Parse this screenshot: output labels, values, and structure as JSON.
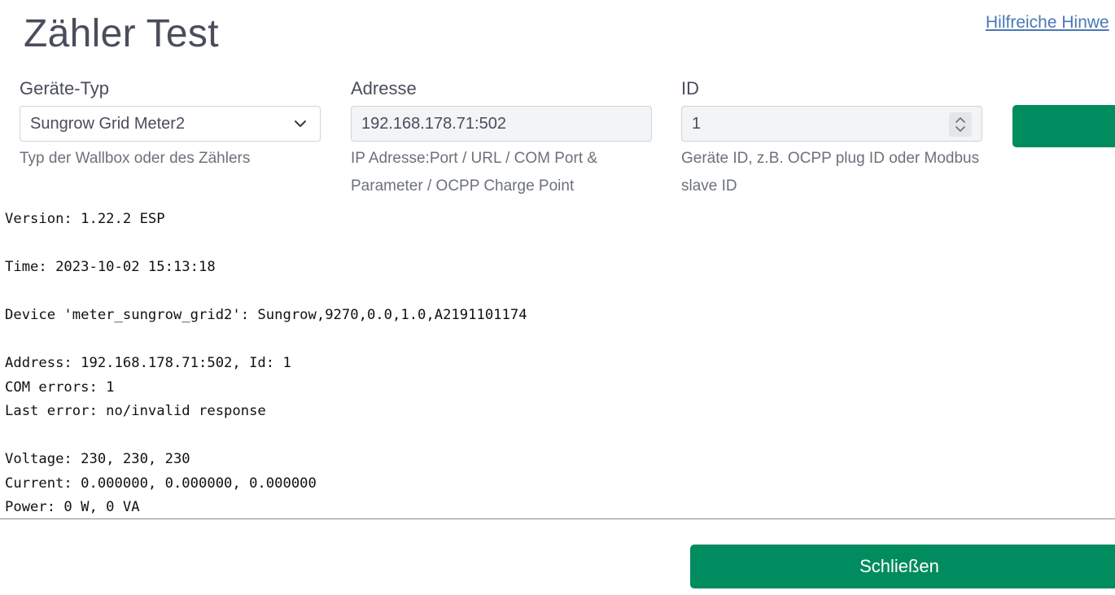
{
  "header": {
    "title": "Zähler Test",
    "help_link": "Hilfreiche Hinwe"
  },
  "form": {
    "device_type": {
      "label": "Geräte-Typ",
      "value": "Sungrow Grid Meter2",
      "help": "Typ der Wallbox oder des Zählers"
    },
    "address": {
      "label": "Adresse",
      "value": "192.168.178.71:502",
      "help_line1": "IP Adresse:Port / URL / COM Port &",
      "help_line2": "Parameter / OCPP Charge Point"
    },
    "id": {
      "label": "ID",
      "value": "1",
      "help_line1": "Geräte ID, z.B. OCPP plug ID oder Modbus",
      "help_line2": "slave ID"
    }
  },
  "console": {
    "lines": [
      "Version: 1.22.2 ESP",
      "",
      "Time: 2023-10-02 15:13:18",
      "",
      "Device 'meter_sungrow_grid2': Sungrow,9270,0.0,1.0,A2191101174",
      "",
      "Address: 192.168.178.71:502, Id: 1",
      "COM errors: 1",
      "Last error: no/invalid response",
      "",
      "Voltage: 230, 230, 230",
      "Current: 0.000000, 0.000000, 0.000000",
      "Power: 0 W, 0 VA"
    ]
  },
  "footer": {
    "close_label": "Schließen"
  },
  "colors": {
    "accent": "#008c5f",
    "link": "#4a78b5",
    "title": "#4a4d5c"
  }
}
